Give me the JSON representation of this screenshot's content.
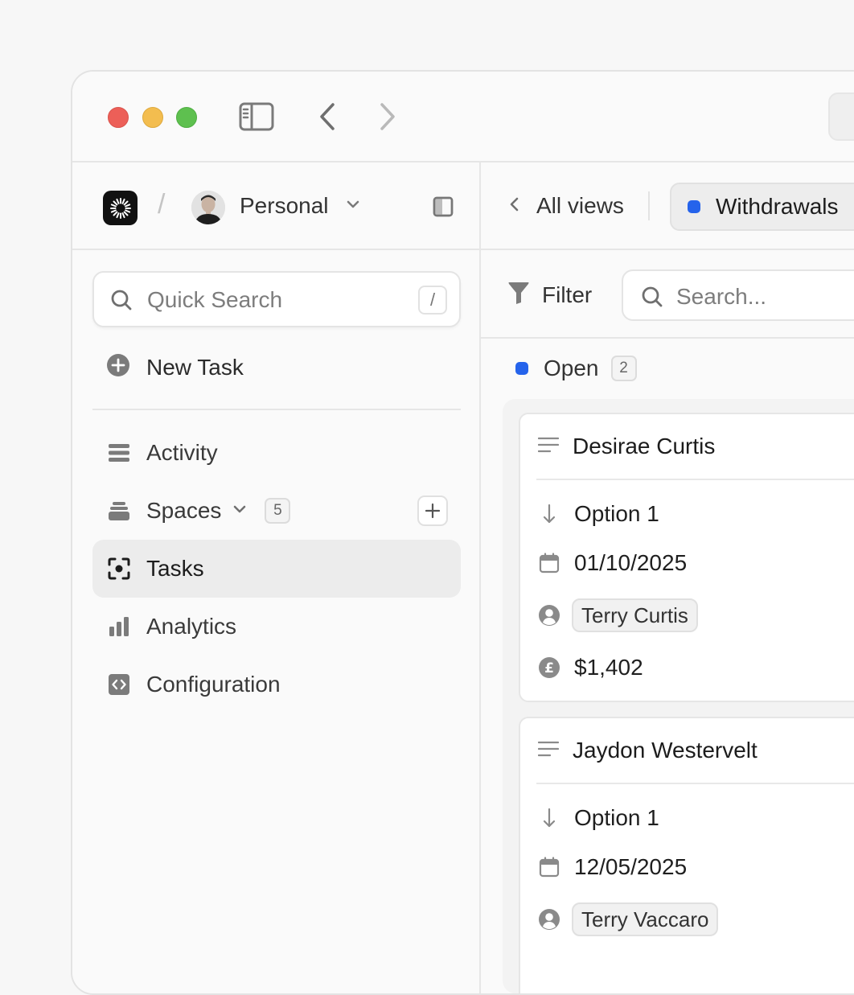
{
  "colors": {
    "accent_blue": "#2563eb",
    "traffic_red": "#ec5f58",
    "traffic_yellow": "#f3bd4f",
    "traffic_green": "#5ec04f"
  },
  "sidebar": {
    "workspace_name": "Personal",
    "breadcrumb_separator": "/",
    "search_placeholder": "Quick Search",
    "search_shortcut": "/",
    "new_task_label": "New Task",
    "nav": {
      "activity": "Activity",
      "spaces": "Spaces",
      "spaces_count": "5",
      "tasks": "Tasks",
      "analytics": "Analytics",
      "configuration": "Configuration"
    },
    "active_item": "Tasks"
  },
  "main": {
    "all_views_label": "All views",
    "active_view_label": "Withdrawals",
    "filter_label": "Filter",
    "search_placeholder": "Search...",
    "group": {
      "label": "Open",
      "count": "2"
    },
    "cards": [
      {
        "title": "Desirae Curtis",
        "option": "Option 1",
        "date": "01/10/2025",
        "assignee": "Terry Curtis",
        "amount": "$1,402"
      },
      {
        "title": "Jaydon Westervelt",
        "option": "Option 1",
        "date": "12/05/2025",
        "assignee": "Terry Vaccaro"
      }
    ]
  }
}
